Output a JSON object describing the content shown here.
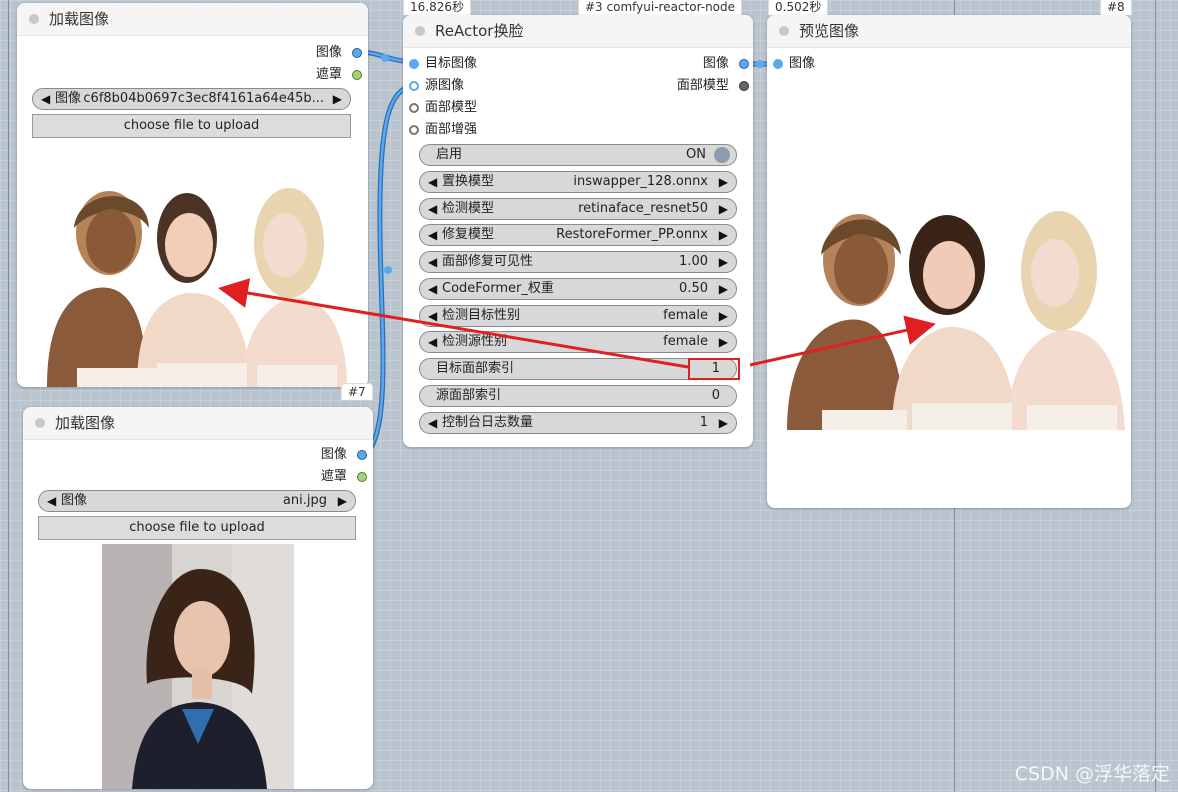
{
  "timings": {
    "reactor": "16.826秒",
    "preview": "0.502秒"
  },
  "nodes": {
    "load1": {
      "title": "加载图像",
      "out_image": "图像",
      "out_mask": "遮罩",
      "image_label": "图像",
      "image_value": "c6f8b04b0697c3ec8f4161a64e45b...",
      "upload": "choose file to upload",
      "id": "#7"
    },
    "load2": {
      "title": "加载图像",
      "out_image": "图像",
      "out_mask": "遮罩",
      "image_label": "图像",
      "image_value": "ani.jpg",
      "upload": "choose file to upload"
    },
    "reactor": {
      "title": "ReActor换脸",
      "id_tag": "#3 comfyui-reactor-node",
      "inputs": [
        "目标图像",
        "源图像",
        "面部模型",
        "面部增强"
      ],
      "outputs": [
        "图像",
        "面部模型"
      ],
      "widgets": [
        {
          "label": "启用",
          "value": "ON"
        },
        {
          "label": "置换模型",
          "value": "inswapper_128.onnx"
        },
        {
          "label": "检测模型",
          "value": "retinaface_resnet50"
        },
        {
          "label": "修复模型",
          "value": "RestoreFormer_PP.onnx"
        },
        {
          "label": "面部修复可见性",
          "value": "1.00"
        },
        {
          "label": "CodeFormer_权重",
          "value": "0.50"
        },
        {
          "label": "检测目标性别",
          "value": "female"
        },
        {
          "label": "检测源性别",
          "value": "female"
        },
        {
          "label": "目标面部索引",
          "value": "1"
        },
        {
          "label": "源面部索引",
          "value": "0"
        },
        {
          "label": "控制台日志数量",
          "value": "1"
        }
      ]
    },
    "preview": {
      "title": "预览图像",
      "id_tag": "#8",
      "input": "图像"
    }
  },
  "watermark": "CSDN @浮华落定",
  "colors": {
    "accent_red": "#e02020",
    "link_blue": "#3c8fd8",
    "canvas": "#b9c4cf"
  }
}
